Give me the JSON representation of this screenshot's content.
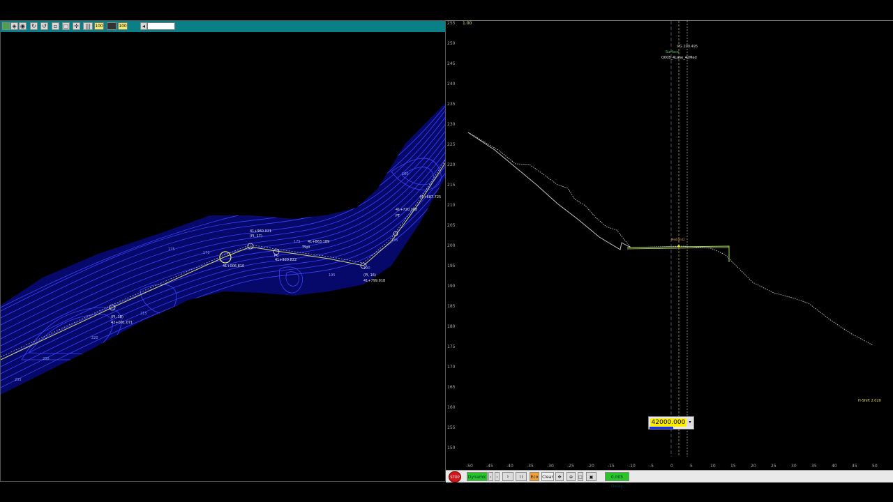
{
  "plan_view": {
    "toolbar": {
      "field_1": "100",
      "field_2": "100",
      "field_3": "100"
    },
    "annotations": [
      {
        "text": "41+960.021"
      },
      {
        "text": "(PI, 17)"
      },
      {
        "text": "41+863.189"
      },
      {
        "text": "41+920.822"
      },
      {
        "text": "41+006.810"
      },
      {
        "text": "(PI, 16)"
      },
      {
        "text": "41+799.918"
      },
      {
        "text": "41+720.268"
      },
      {
        "text": "41+687.725"
      },
      {
        "text": "(PI, 18)"
      },
      {
        "text": "42+001.071"
      },
      {
        "text": "PC"
      },
      {
        "text": "PT"
      },
      {
        "text": "TSpt"
      }
    ],
    "contour_labels": [
      "175",
      "170",
      "175",
      "180",
      "185",
      "190",
      "195",
      "200",
      "205",
      "210",
      "215",
      "220",
      "225",
      "230",
      "235"
    ]
  },
  "profile_view": {
    "y_ticks": [
      "255",
      "250",
      "245",
      "240",
      "235",
      "230",
      "225",
      "220",
      "215",
      "210",
      "205",
      "200",
      "195",
      "190",
      "185",
      "180",
      "175",
      "170",
      "165",
      "160",
      "155",
      "150"
    ],
    "x_ticks": [
      "-50",
      "-45",
      "-40",
      "-35",
      "-30",
      "-25",
      "-20",
      "-15",
      "-10",
      "-5",
      "0",
      "5",
      "10",
      "15",
      "20",
      "25",
      "30",
      "35",
      "40",
      "45",
      "50"
    ],
    "corner_scale": "1.00",
    "pg_label": "PG 200.495",
    "surface_label": "Surface",
    "template_label": "Q008_4Lane_42Med",
    "median_label": "Median42",
    "h_shift": "H-Shift 2.020",
    "station": "42000.000",
    "station_dropdown_icon": "chevron-down-icon",
    "colors": {
      "surface": "#cfcfcf",
      "template": "#9adf60",
      "pg": "#ffee00",
      "station_field": "#ffee00"
    }
  },
  "bottom_bar": {
    "stop": "STOP",
    "dynamic": "Dynamic",
    "eco": "Eco",
    "clear": "Clear",
    "delay": "0.005 Delay"
  }
}
